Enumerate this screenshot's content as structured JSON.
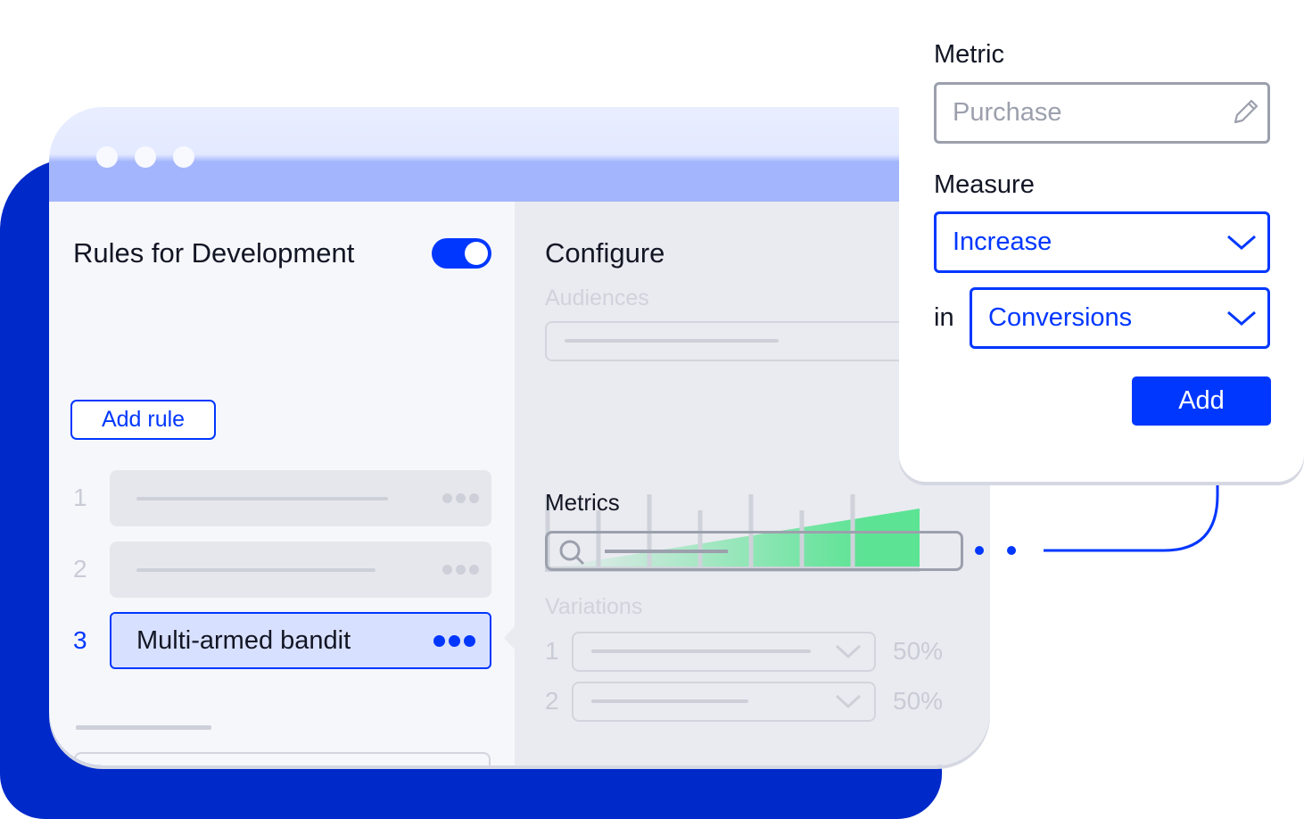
{
  "left": {
    "title": "Rules for Development",
    "toggle_on": true,
    "add_rule_label": "Add rule",
    "rules": [
      {
        "number": "1"
      },
      {
        "number": "2"
      },
      {
        "number": "3",
        "label": "Multi-armed bandit",
        "selected": true
      }
    ]
  },
  "right": {
    "title": "Configure",
    "audiences_label": "Audiences",
    "metrics_label": "Metrics",
    "variations_label": "Variations",
    "variations": [
      {
        "number": "1",
        "percent": "50%"
      },
      {
        "number": "2",
        "percent": "50%"
      }
    ]
  },
  "card": {
    "metric_label": "Metric",
    "metric_value": "Purchase",
    "measure_label": "Measure",
    "measure_value": "Increase",
    "in_label": "in",
    "in_value": "Conversions",
    "add_label": "Add"
  },
  "colors": {
    "accent": "#0037ff",
    "backdrop": "#0029c9",
    "chart_green": "#5ce394"
  }
}
